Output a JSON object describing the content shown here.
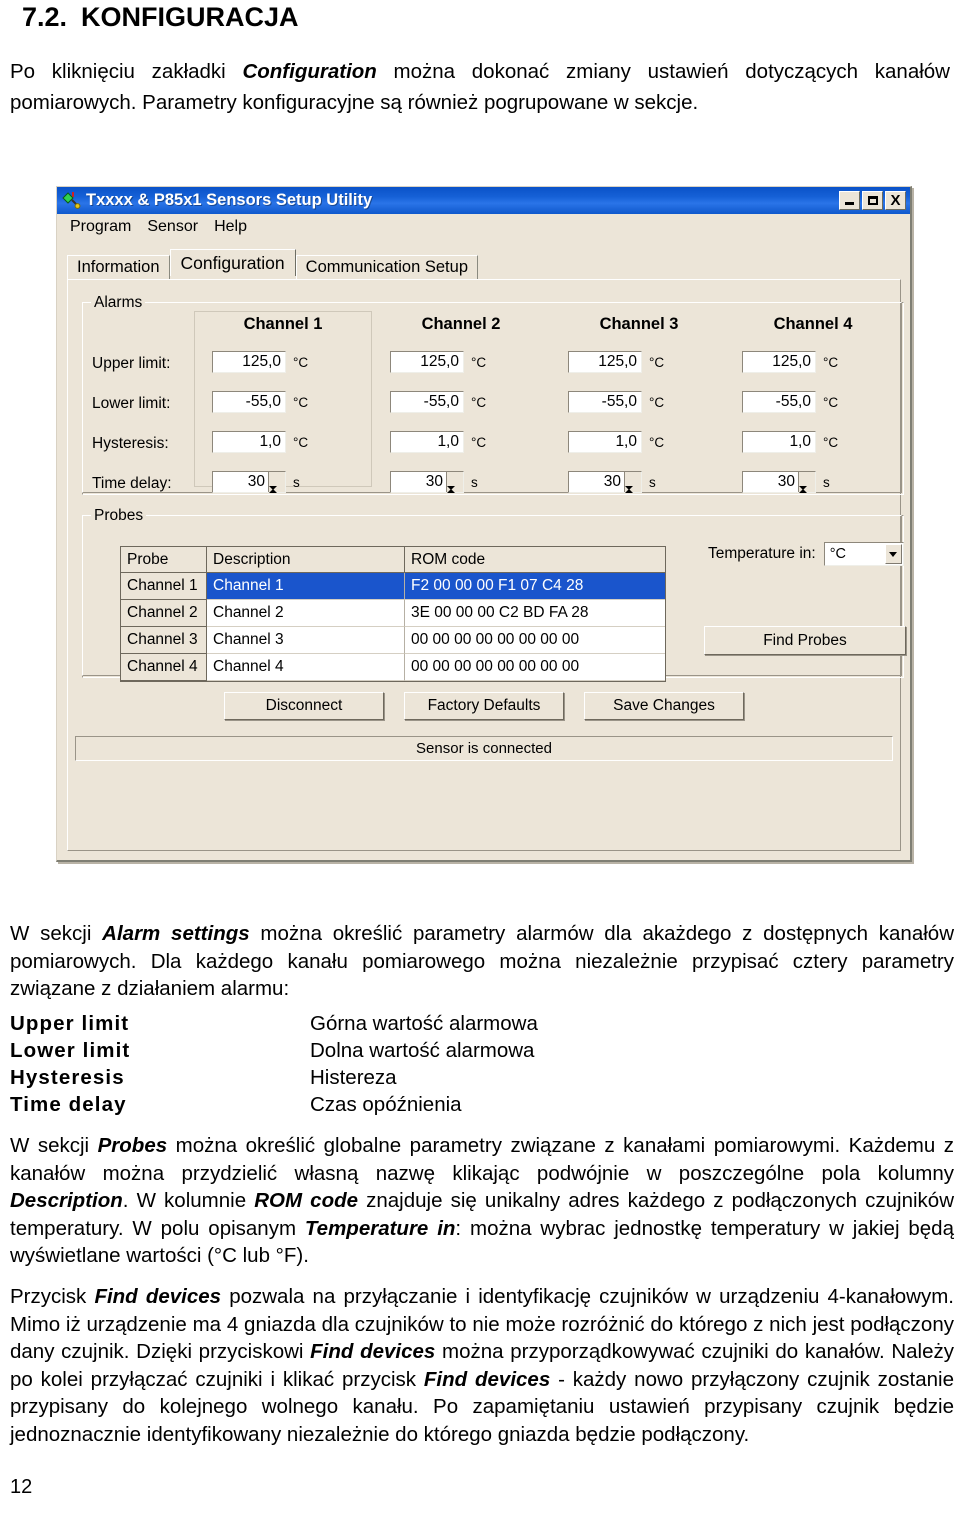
{
  "doc": {
    "section_number": "7.2.",
    "section_title": "KONFIGURACJA",
    "intro_1": "Po kliknięciu zakładki ",
    "intro_bold": "Configuration",
    "intro_2": " można dokonać zmiany ustawień dotyczących kanałów pomiarowych. Parametry konfiguracyjne są również pogrupowane w sekcje.",
    "page_number": "12"
  },
  "app": {
    "title": "Txxxx & P85x1 Sensors Setup Utility",
    "icon": "sensor-icon",
    "window_buttons": {
      "minimize": "minimize-icon",
      "maximize": "maximize-icon",
      "close": "X"
    },
    "menu": [
      "Program",
      "Sensor",
      "Help"
    ],
    "tabs": [
      {
        "label": "Information",
        "active": false
      },
      {
        "label": "Configuration",
        "active": true
      },
      {
        "label": "Communication Setup",
        "active": false
      }
    ],
    "alarms": {
      "group_label": "Alarms",
      "row_labels": [
        "Upper limit:",
        "Lower limit:",
        "Hysteresis:",
        "Time delay:"
      ],
      "channels": [
        {
          "header": "Channel 1",
          "upper_limit": "125,0",
          "upper_unit": "°C",
          "lower_limit": "-55,0",
          "lower_unit": "°C",
          "hysteresis": "1,0",
          "hysteresis_unit": "°C",
          "time_delay": "30",
          "time_delay_unit": "s"
        },
        {
          "header": "Channel 2",
          "upper_limit": "125,0",
          "upper_unit": "°C",
          "lower_limit": "-55,0",
          "lower_unit": "°C",
          "hysteresis": "1,0",
          "hysteresis_unit": "°C",
          "time_delay": "30",
          "time_delay_unit": "s"
        },
        {
          "header": "Channel 3",
          "upper_limit": "125,0",
          "upper_unit": "°C",
          "lower_limit": "-55,0",
          "lower_unit": "°C",
          "hysteresis": "1,0",
          "hysteresis_unit": "°C",
          "time_delay": "30",
          "time_delay_unit": "s"
        },
        {
          "header": "Channel 4",
          "upper_limit": "125,0",
          "upper_unit": "°C",
          "lower_limit": "-55,0",
          "lower_unit": "°C",
          "hysteresis": "1,0",
          "hysteresis_unit": "°C",
          "time_delay": "30",
          "time_delay_unit": "s"
        }
      ]
    },
    "probes": {
      "group_label": "Probes",
      "columns": [
        "Probe",
        "Description",
        "ROM code"
      ],
      "rows": [
        {
          "probe": "Channel 1",
          "description": "Channel 1",
          "rom": "F2 00 00 00 F1 07 C4 28",
          "selected": true
        },
        {
          "probe": "Channel 2",
          "description": "Channel 2",
          "rom": "3E 00 00 00 C2 BD FA 28",
          "selected": false
        },
        {
          "probe": "Channel 3",
          "description": "Channel 3",
          "rom": "00 00 00 00 00 00 00 00",
          "selected": false
        },
        {
          "probe": "Channel 4",
          "description": "Channel 4",
          "rom": "00 00 00 00 00 00 00 00",
          "selected": false
        }
      ],
      "temperature_in_label": "Temperature in:",
      "temperature_in_value": "°C",
      "find_probes_label": "Find Probes"
    },
    "buttons": {
      "disconnect": "Disconnect",
      "factory_defaults": "Factory Defaults",
      "save_changes": "Save Changes"
    },
    "status": "Sensor is connected"
  },
  "body": {
    "p1_a": "W sekcji ",
    "p1_b": "Alarm settings",
    "p1_c": " można określić parametry alarmów dla akażdego z dostępnych kanałów pomiarowych. Dla każdego kanału pomiarowego można niezależnie przypisać cztery parametry związane z działaniem alarmu:",
    "definitions": [
      {
        "term": "Upper limit",
        "desc": "Górna wartość alarmowa"
      },
      {
        "term": "Lower limit",
        "desc": "Dolna wartość alarmowa"
      },
      {
        "term": "Hysteresis",
        "desc": "Histereza"
      },
      {
        "term": "Time delay",
        "desc": "Czas opóźnienia"
      }
    ],
    "p2_a": "W sekcji ",
    "p2_b": "Probes",
    "p2_c": " można określić globalne parametry związane z kanałami pomiarowymi. Każdemu z kanałów można przydzielić własną nazwę klikając podwójnie w poszczególne pola kolumny ",
    "p2_d": "Description",
    "p2_e": ". W kolumnie ",
    "p2_f": "ROM code",
    "p2_g": " znajduje się unikalny adres każdego z podłączonych czujników temperatury. W polu opisanym ",
    "p2_h": "Temperature in",
    "p2_i": ": można wybrac jednostkę temperatury w jakiej będą wyświetlane wartości (°C lub °F).",
    "p3_a": "Przycisk ",
    "p3_b": "Find devices",
    "p3_c": " pozwala na przyłączanie i identyfikację czujników w urządzeniu 4-kanałowym. Mimo iż urządzenie ma 4 gniazda dla czujników to nie może rozróżnić do którego z nich jest podłączony dany czujnik. Dzięki przyciskowi ",
    "p3_d": "Find devices",
    "p3_e": " można przyporządkowywać czujniki do kanałów. Należy po kolei przyłączać czujniki i klikać przycisk ",
    "p3_f": "Find devices",
    "p3_g": " - każdy nowo przyłączony czujnik zostanie przypisany do kolejnego wolnego kanału. Po zapamiętaniu ustawień przypisany czujnik będzie jednoznacznie identyfikowany niezależnie do którego gniazda będzie podłączony."
  }
}
